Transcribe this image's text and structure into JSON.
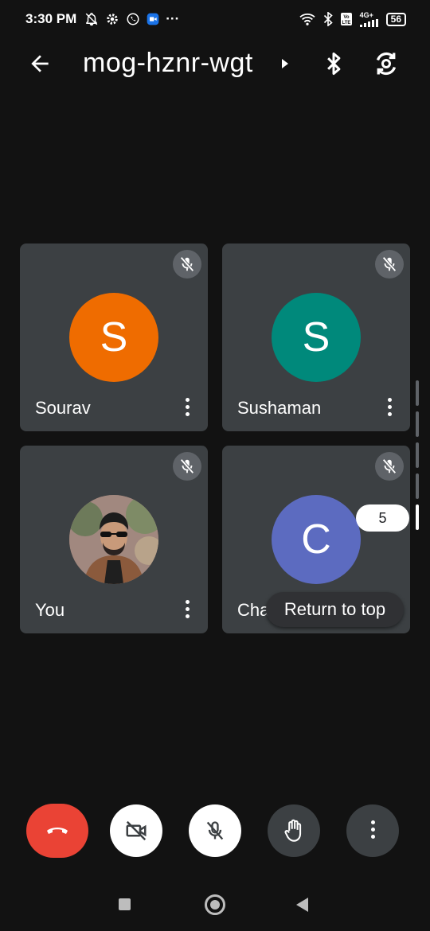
{
  "status": {
    "time": "3:30 PM",
    "more": "···",
    "network_label": "4G+",
    "battery": "56"
  },
  "header": {
    "meeting_code": "mog-hznr-wgt"
  },
  "participants": [
    {
      "name": "Sourav",
      "initial": "S",
      "color": "#ef6c00"
    },
    {
      "name": "Sushaman",
      "initial": "S",
      "color": "#00897b"
    },
    {
      "name": "You",
      "initial": "",
      "color": "#8d6e63"
    },
    {
      "name": "Chaa",
      "initial": "C",
      "color": "#5c6bc0"
    }
  ],
  "overlay": {
    "count_badge": "5",
    "return_to_top": "Return to top"
  },
  "colors": {
    "end_call": "#ea4335",
    "tile_bg": "#3c4043",
    "background": "#121212"
  },
  "icons": {
    "back": "arrow-left-icon",
    "bluetooth": "bluetooth-icon",
    "switch_camera": "camera-switch-icon",
    "mic_off": "mic-off-icon",
    "end_call": "phone-hangup-icon",
    "camera_off": "video-off-icon",
    "hand": "hand-raise-icon",
    "more": "more-vertical-icon"
  }
}
